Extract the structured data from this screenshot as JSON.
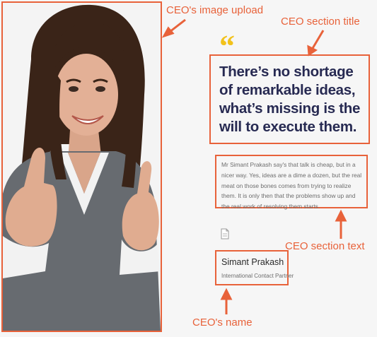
{
  "annotations": {
    "image_upload": "CEO's image upload",
    "section_title": "CEO section title",
    "section_text": "CEO section text",
    "name": "CEO's name"
  },
  "ceo_section": {
    "quote_icon": "quote-icon",
    "title": "There’s no shortage of remarkable ideas, what’s missing is the will to execute them.",
    "text": "Mr Simant Prakash say's that talk is cheap, but in a nicer way. Yes, ideas are a dime a dozen, but the real meat on those bones comes from trying to realize them. It is only then that the problems show up and the real work of resolving them starts.",
    "name": "Simant Prakash",
    "role": "International Contact Partner"
  },
  "colors": {
    "annotation": "#e8623a",
    "quote_icon": "#f2c21b",
    "title_text": "#272a52",
    "body_text": "#6d6d6d"
  }
}
